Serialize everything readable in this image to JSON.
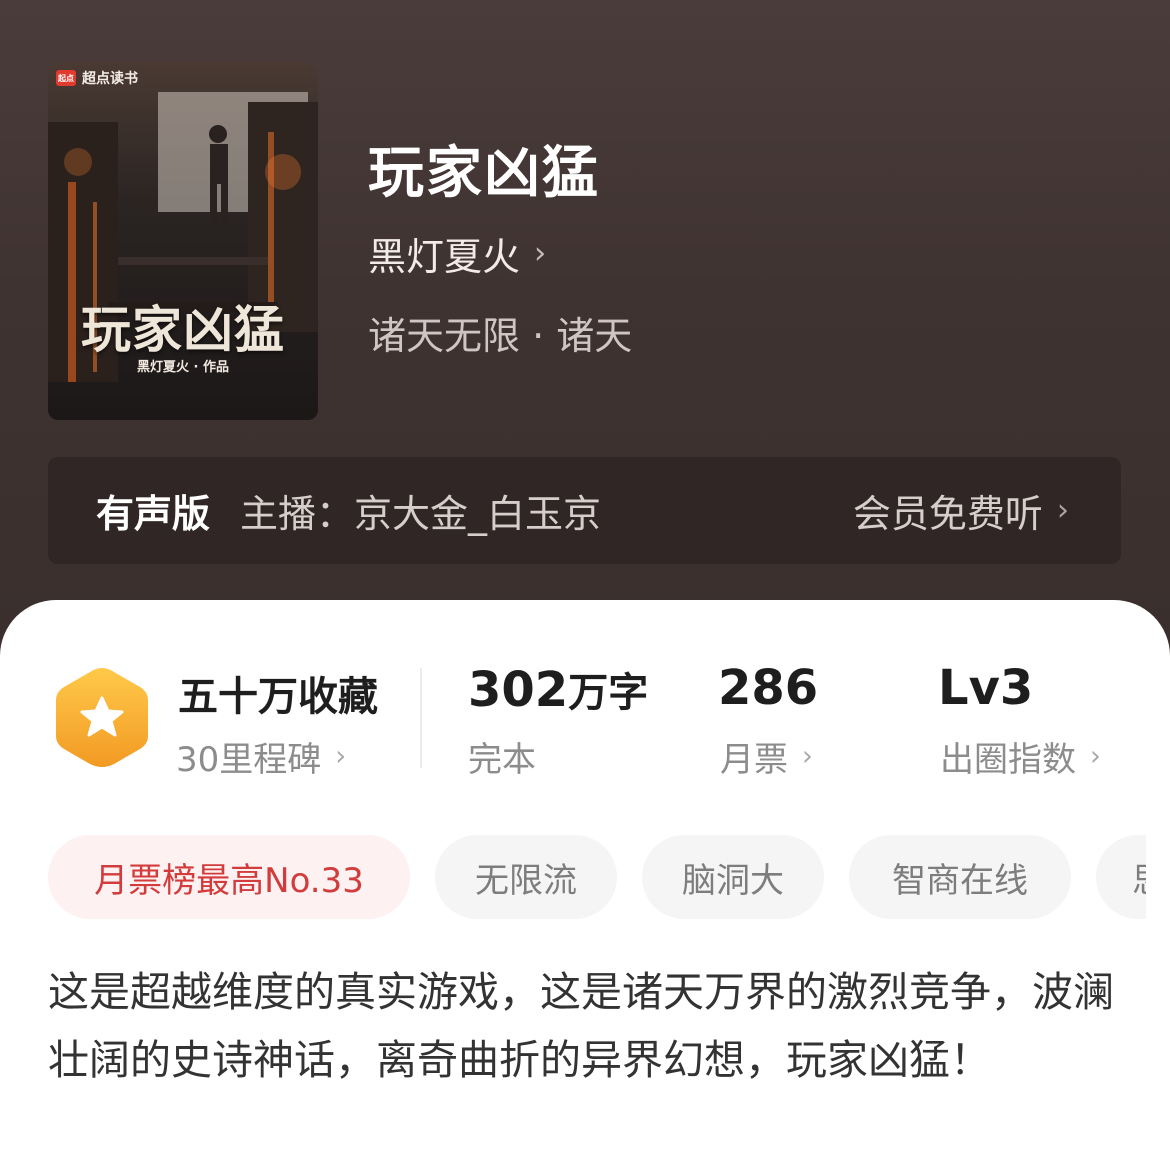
{
  "cover": {
    "brand": "超点读书",
    "title": "玩家凶猛",
    "author_line": "黑灯夏火 · 作品"
  },
  "book": {
    "title": "玩家凶猛",
    "author": "黑灯夏火",
    "genre": "诸天无限 · 诸天"
  },
  "audio": {
    "label": "有声版",
    "host": "主播：京大金_白玉京",
    "free_listen": "会员免费听"
  },
  "stats": {
    "collection": {
      "main": "五十万收藏",
      "sub": "30里程碑"
    },
    "words": {
      "number": "302",
      "unit": "万字",
      "sub": "完本"
    },
    "monthly_ticket": {
      "number": "286",
      "sub": "月票"
    },
    "level": {
      "number": "Lv3",
      "sub": "出圈指数"
    }
  },
  "tags": [
    {
      "label": "月票榜最高No.33"
    },
    {
      "label": "无限流"
    },
    {
      "label": "脑洞大"
    },
    {
      "label": "智商在线"
    },
    {
      "label": "思"
    }
  ],
  "synopsis": "这是超越维度的真实游戏，这是诸天万界的激烈竞争，波澜壮阔的史诗神话，离奇曲折的异界幻想，玩家凶猛！",
  "colors": {
    "hero_bg": "#3f3331",
    "badge_gold": "#f6b73c",
    "rank_tag_text": "#d23c3c"
  }
}
